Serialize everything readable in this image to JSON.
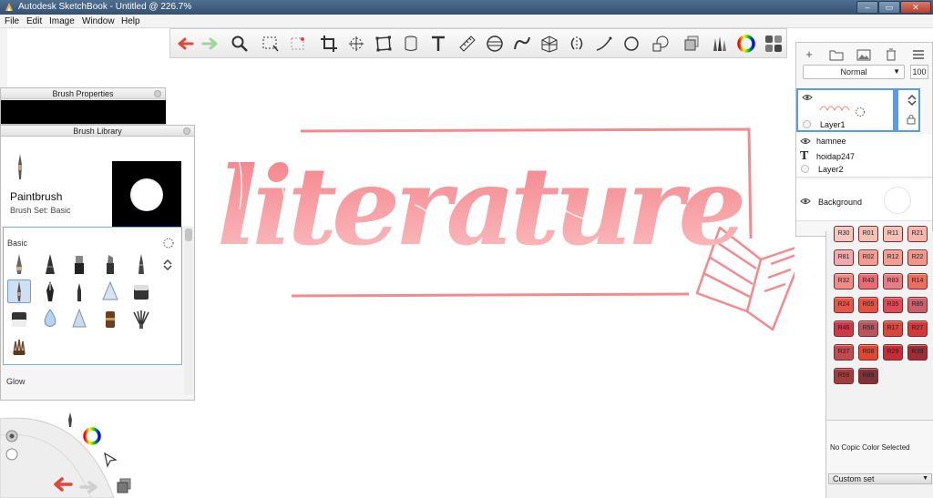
{
  "window": {
    "title": "Autodesk SketchBook - Untitled @ 226.7%"
  },
  "menu": [
    "File",
    "Edit",
    "Image",
    "Window",
    "Help"
  ],
  "toolbar": {
    "tools": [
      "undo-icon",
      "redo-icon",
      "zoom-icon",
      "rect-select-icon",
      "lasso-select-icon",
      "crop-icon",
      "transform-icon",
      "distort-icon",
      "fill-icon",
      "text-icon",
      "ruler-icon",
      "ellipse-guide-icon",
      "french-curve-icon",
      "perspective-icon",
      "symmetry-icon",
      "stroke-icon",
      "circle-icon",
      "shape-icon",
      "layers-icon",
      "brushes-icon",
      "color-wheel-icon",
      "swatches-icon"
    ]
  },
  "brush_properties": {
    "title": "Brush Properties"
  },
  "brush_library": {
    "title": "Brush Library",
    "current_brush": "Paintbrush",
    "brush_set": "Brush Set: Basic",
    "category": "Basic",
    "next_category": "Glow",
    "brushes": [
      "pencil",
      "technical-pen",
      "marker",
      "chisel-marker",
      "ballpoint",
      "paintbrush",
      "ink-pen",
      "felt-tip",
      "airbrush-cone",
      "eraser-block",
      "eraser",
      "smudge-drop",
      "blur-cone",
      "watercolor",
      "fan-brush",
      "bristle-brush"
    ]
  },
  "layers": {
    "blend_mode": "Normal",
    "opacity": "100",
    "items": [
      {
        "name": "Layer1",
        "selected": true
      },
      {
        "name": "hamnee",
        "type": "group"
      },
      {
        "name": "hoidap247",
        "type": "text"
      },
      {
        "name": "Layer2",
        "type": "layer"
      },
      {
        "name": "Background",
        "type": "background"
      }
    ]
  },
  "copic": {
    "swatches": [
      {
        "code": "R30",
        "color": "#f5c9c2"
      },
      {
        "code": "R01",
        "color": "#f3c0b5"
      },
      {
        "code": "R11",
        "color": "#f6c1b6"
      },
      {
        "code": "R21",
        "color": "#f4b6ad"
      },
      {
        "code": "R81",
        "color": "#f0a9ac"
      },
      {
        "code": "R02",
        "color": "#f19c8d"
      },
      {
        "code": "R12",
        "color": "#f39e92"
      },
      {
        "code": "R22",
        "color": "#f2958a"
      },
      {
        "code": "R32",
        "color": "#ee8c86"
      },
      {
        "code": "R43",
        "color": "#e96a70"
      },
      {
        "code": "R83",
        "color": "#e67e86"
      },
      {
        "code": "R14",
        "color": "#ea6e5e"
      },
      {
        "code": "R24",
        "color": "#e4554a"
      },
      {
        "code": "R05",
        "color": "#e5503f"
      },
      {
        "code": "R35",
        "color": "#de4a55"
      },
      {
        "code": "R85",
        "color": "#c9606b"
      },
      {
        "code": "R46",
        "color": "#cc3a4a"
      },
      {
        "code": "R56",
        "color": "#b8545e"
      },
      {
        "code": "R17",
        "color": "#d9473b"
      },
      {
        "code": "R27",
        "color": "#d23a3a"
      },
      {
        "code": "R37",
        "color": "#c24a4f"
      },
      {
        "code": "R08",
        "color": "#e3452f"
      },
      {
        "code": "R29",
        "color": "#c52c36"
      },
      {
        "code": "R39",
        "color": "#9c2c36"
      },
      {
        "code": "R59",
        "color": "#a03d3d"
      },
      {
        "code": "R89",
        "color": "#7f3339"
      }
    ],
    "empty_message": "No Copic Color Selected",
    "custom_set_label": "Custom set"
  },
  "canvas": {
    "lettering": "literature",
    "accent_color": "#f48a8f"
  }
}
